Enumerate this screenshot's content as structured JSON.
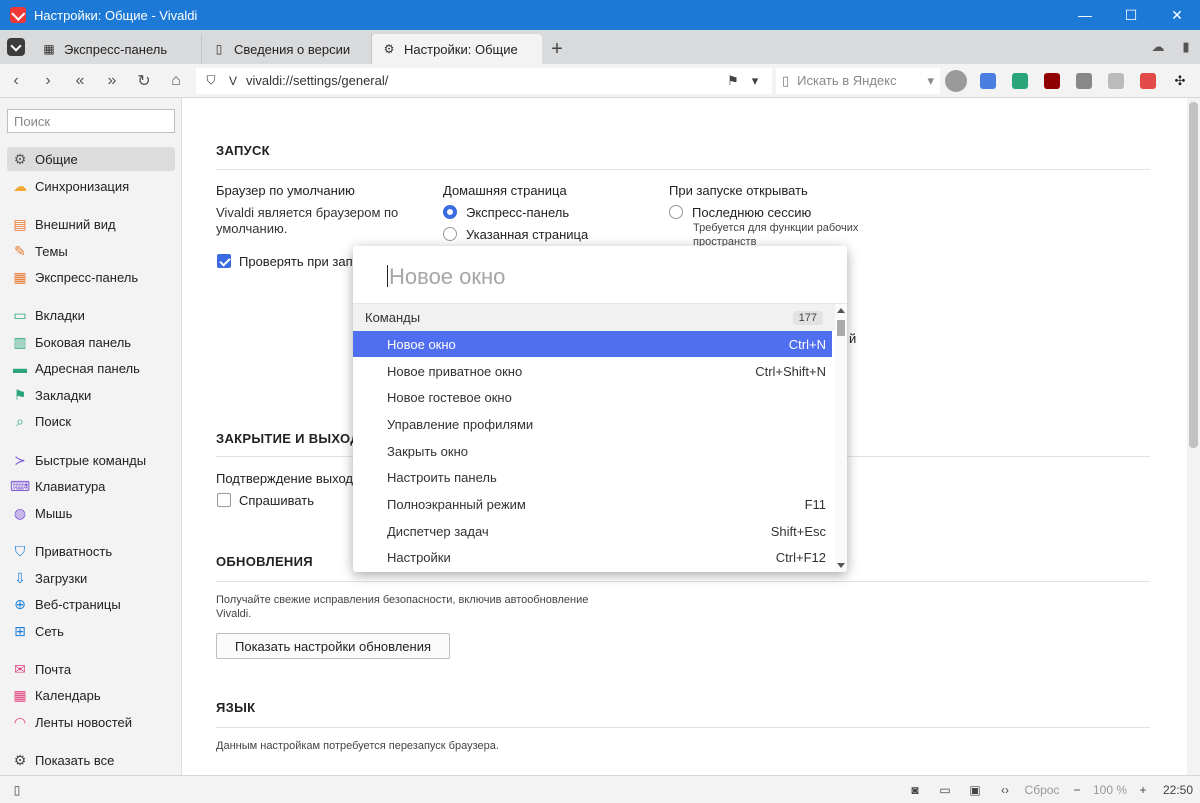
{
  "window": {
    "title": "Настройки: Общие - Vivaldi",
    "controls": [
      "—",
      "☐",
      "✕"
    ]
  },
  "tabs": [
    {
      "label": "Экспресс-панель",
      "icon": "grid-icon",
      "glyph": "▦"
    },
    {
      "label": "Сведения о версии",
      "icon": "page-icon",
      "glyph": "▯"
    },
    {
      "label": "Настройки: Общие",
      "icon": "gear-icon",
      "glyph": "⚙",
      "active": true
    }
  ],
  "addressbar": {
    "url": "vivaldi://settings/general/",
    "search_placeholder": "Искать в Яндекс"
  },
  "sidebar": {
    "search_placeholder": "Поиск",
    "items": [
      {
        "label": "Общие",
        "icon": "general-icon",
        "glyph": "⚙",
        "color": "#555555",
        "active": true
      },
      {
        "label": "Синхронизация",
        "icon": "cloud-icon",
        "glyph": "☁",
        "color": "#f0a830"
      },
      {
        "label": "Внешний вид",
        "icon": "appearance-icon",
        "glyph": "▤",
        "color": "#e8772e"
      },
      {
        "label": "Темы",
        "icon": "brush-icon",
        "glyph": "✎",
        "color": "#e8772e"
      },
      {
        "label": "Экспресс-панель",
        "icon": "speeddial-icon",
        "glyph": "▦",
        "color": "#e8772e"
      },
      {
        "label": "Вкладки",
        "icon": "tabs-icon",
        "glyph": "▭",
        "color": "#2aa57a"
      },
      {
        "label": "Боковая панель",
        "icon": "panel-icon",
        "glyph": "▥",
        "color": "#2aa57a"
      },
      {
        "label": "Адресная панель",
        "icon": "addressbar-icon",
        "glyph": "▬",
        "color": "#2aa57a"
      },
      {
        "label": "Закладки",
        "icon": "bookmark-icon",
        "glyph": "⚑",
        "color": "#2aa57a"
      },
      {
        "label": "Поиск",
        "icon": "search-icon",
        "glyph": "⌕",
        "color": "#2aa57a"
      },
      {
        "label": "Быстрые команды",
        "icon": "commands-icon",
        "glyph": "≻",
        "color": "#7e5bd8"
      },
      {
        "label": "Клавиатура",
        "icon": "keyboard-icon",
        "glyph": "⌨",
        "color": "#7e5bd8"
      },
      {
        "label": "Мышь",
        "icon": "mouse-icon",
        "glyph": "◍",
        "color": "#7e5bd8"
      },
      {
        "label": "Приватность",
        "icon": "shield-icon",
        "glyph": "⛉",
        "color": "#1b7fd6"
      },
      {
        "label": "Загрузки",
        "icon": "download-icon",
        "glyph": "⇩",
        "color": "#1b7fd6"
      },
      {
        "label": "Веб-страницы",
        "icon": "globe-icon",
        "glyph": "⊕",
        "color": "#1b7fd6"
      },
      {
        "label": "Сеть",
        "icon": "network-icon",
        "glyph": "⊞",
        "color": "#1b7fd6"
      },
      {
        "label": "Почта",
        "icon": "mail-icon",
        "glyph": "✉",
        "color": "#e03d7a"
      },
      {
        "label": "Календарь",
        "icon": "calendar-icon",
        "glyph": "▦",
        "color": "#e03d7a"
      },
      {
        "label": "Ленты новостей",
        "icon": "rss-icon",
        "glyph": "◠",
        "color": "#e03d7a"
      },
      {
        "label": "Показать все",
        "icon": "gear-icon",
        "glyph": "⚙",
        "color": "#444444"
      }
    ]
  },
  "settings": {
    "startup": {
      "title": "ЗАПУСК",
      "default_browser_label": "Браузер по умолчанию",
      "default_browser_text_1": "Vivaldi является браузером по",
      "default_browser_text_2": "умолчанию.",
      "check_on_startup": "Проверять при запу",
      "homepage_label": "Домашняя страница",
      "homepage_options": [
        "Экспресс-панель",
        "Указанная страница"
      ],
      "on_start_label": "При запуске открывать",
      "on_start_option": "Последнюю сессию",
      "on_start_hint_1": "Требуется для функции рабочих",
      "on_start_hint_2": "пространств",
      "partial_char": "й"
    },
    "exit": {
      "title": "ЗАКРЫТИЕ И ВЫХОД",
      "confirm_label": "Подтверждение выхода",
      "ask_label": "Спрашивать"
    },
    "updates": {
      "title": "ОБНОВЛЕНИЯ",
      "text_1": "Получайте свежие исправления безопасности, включив автообновление",
      "text_2": "Vivaldi.",
      "button": "Показать настройки обновления"
    },
    "language": {
      "title": "ЯЗЫК",
      "text": "Данным настройкам потребуется перезапуск браузера."
    }
  },
  "palette": {
    "placeholder": "Новое окно",
    "header": "Команды",
    "count": "177",
    "rows": [
      {
        "label": "Новое окно",
        "shortcut": "Ctrl+N",
        "selected": true
      },
      {
        "label": "Новое приватное окно",
        "shortcut": "Ctrl+Shift+N"
      },
      {
        "label": "Новое гостевое окно",
        "shortcut": ""
      },
      {
        "label": "Управление профилями",
        "shortcut": ""
      },
      {
        "label": "Закрыть окно",
        "shortcut": ""
      },
      {
        "label": "Настроить панель",
        "shortcut": ""
      },
      {
        "label": "Полноэкранный режим",
        "shortcut": "F11"
      },
      {
        "label": "Диспетчер задач",
        "shortcut": "Shift+Esc"
      },
      {
        "label": "Настройки",
        "shortcut": "Ctrl+F12"
      }
    ]
  },
  "statusbar": {
    "reset": "Сброс",
    "zoom": "100 %",
    "clock": "22:50"
  },
  "colors": {
    "titlebar": "#1c79d6",
    "accent": "#3b6be0",
    "selection": "#4f6ff0"
  }
}
